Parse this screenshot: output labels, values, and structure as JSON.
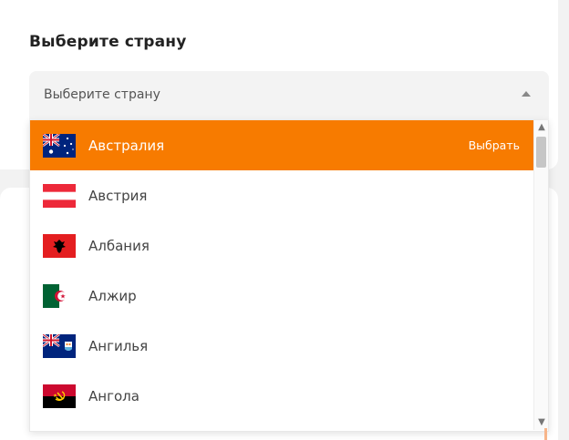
{
  "heading": "Выберите страну",
  "select": {
    "placeholder": "Выберите страну",
    "arrow_icon": "triangle-up-icon"
  },
  "options": [
    {
      "label": "Австралия",
      "flag": "australia-flag",
      "action": "Выбрать",
      "active": true
    },
    {
      "label": "Австрия",
      "flag": "austria-flag",
      "active": false
    },
    {
      "label": "Албания",
      "flag": "albania-flag",
      "active": false
    },
    {
      "label": "Алжир",
      "flag": "algeria-flag",
      "active": false
    },
    {
      "label": "Ангилья",
      "flag": "anguilla-flag",
      "active": false
    },
    {
      "label": "Ангола",
      "flag": "angola-flag",
      "active": false
    }
  ],
  "colors": {
    "accent": "#f77b00",
    "page_bg": "#f2f2f2",
    "select_bg": "#f3f3f3"
  }
}
